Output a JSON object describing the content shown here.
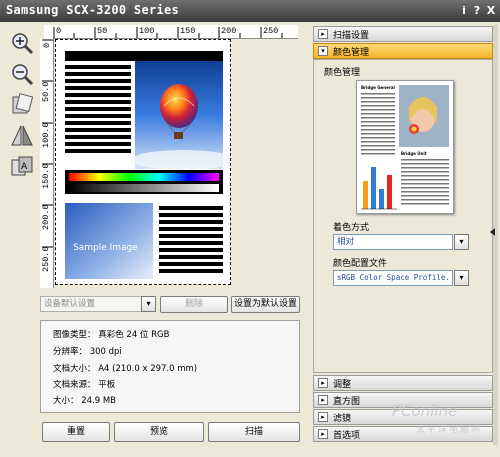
{
  "window": {
    "title": "Samsung SCX-3200 Series",
    "help": "i",
    "help_q": "?",
    "close": "X"
  },
  "ruler": {
    "top": [
      "0",
      "50",
      "100",
      "150",
      "200",
      "250"
    ],
    "left": [
      "0",
      "50.0",
      "100.0",
      "150.0",
      "200.0",
      "250.0"
    ]
  },
  "preview": {
    "sample_text": "Sample Image"
  },
  "settings_row": {
    "preset_value": "设备默认设置",
    "delete_label": "删除",
    "set_default_label": "设置为默认设置"
  },
  "info": {
    "image_type": "图像类型： 真彩色 24 位 RGB",
    "resolution": "分辨率： 300 dpi",
    "doc_size": "文档大小： A4 (210.0 x 297.0 mm)",
    "doc_source": "文档来源： 平板",
    "size": "大小： 24.9 MB"
  },
  "bottom_buttons": {
    "reset": "重置",
    "preview": "预览",
    "scan": "扫描"
  },
  "right_panel": {
    "top_sections": [
      {
        "label": "扫描设置",
        "arrow": "▸"
      },
      {
        "label": "颜色管理",
        "arrow": "▾"
      }
    ],
    "color_mgmt": {
      "heading": "颜色管理",
      "thumb_title": "Bridge General",
      "thumb_sub": "Bridge Unit",
      "tone_label": "着色方式",
      "tone_value": "相对",
      "profile_label": "颜色配置文件",
      "profile_value": "sRGB Color Space Profile."
    },
    "bottom_sections": [
      {
        "label": "调整",
        "arrow": "▸"
      },
      {
        "label": "直方图",
        "arrow": "▸"
      },
      {
        "label": "滤镜",
        "arrow": "▸"
      },
      {
        "label": "首选项",
        "arrow": "▸"
      }
    ]
  },
  "watermark": {
    "brand": "PConline",
    "cn": "太平洋电脑网"
  },
  "icons": [
    "zoom-in-icon",
    "zoom-out-icon",
    "rotate-icon",
    "flip-icon",
    "auto-fit-icon"
  ]
}
